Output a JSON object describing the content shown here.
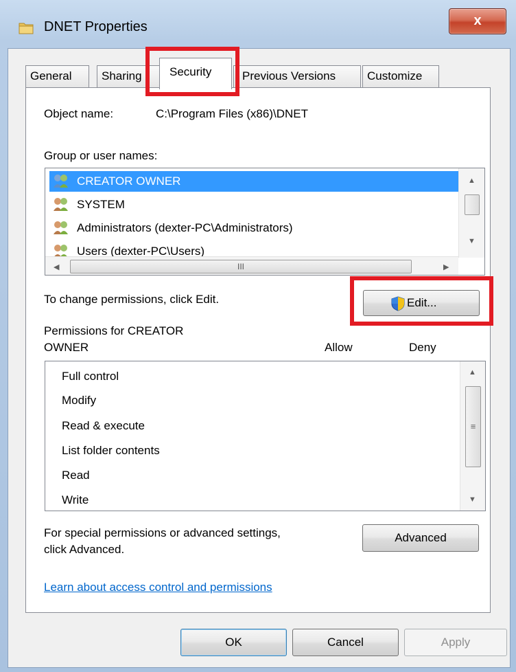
{
  "window": {
    "title": "DNET Properties",
    "close_label": "x"
  },
  "tabs": [
    {
      "label": "General"
    },
    {
      "label": "Sharing"
    },
    {
      "label": "Security",
      "active": true
    },
    {
      "label": "Previous Versions"
    },
    {
      "label": "Customize"
    }
  ],
  "object": {
    "label": "Object name:",
    "value": "C:\\Program Files (x86)\\DNET"
  },
  "groups": {
    "label": "Group or user names:",
    "items": [
      {
        "name": "CREATOR OWNER",
        "selected": true
      },
      {
        "name": "SYSTEM"
      },
      {
        "name": "Administrators (dexter-PC\\Administrators)"
      },
      {
        "name": "Users (dexter-PC\\Users)"
      }
    ],
    "hscroll_thumb_glyph": "III"
  },
  "change": {
    "text": "To change permissions, click Edit.",
    "edit_label": "Edit..."
  },
  "permissions": {
    "header_line1": "Permissions for CREATOR",
    "header_line2": "OWNER",
    "allow_label": "Allow",
    "deny_label": "Deny",
    "items": [
      "Full control",
      "Modify",
      "Read & execute",
      "List folder contents",
      "Read",
      "Write"
    ],
    "vscroll_thumb_glyph": "≡"
  },
  "advanced": {
    "text_line1": "For special permissions or advanced settings,",
    "text_line2": "click Advanced.",
    "button_label": "Advanced"
  },
  "link": {
    "text": "Learn about access control and permissions"
  },
  "footer": {
    "ok_label": "OK",
    "cancel_label": "Cancel",
    "apply_label": "Apply"
  },
  "colors": {
    "selection": "#3399ff",
    "highlight_box": "#e21b23",
    "link": "#0066cc"
  }
}
